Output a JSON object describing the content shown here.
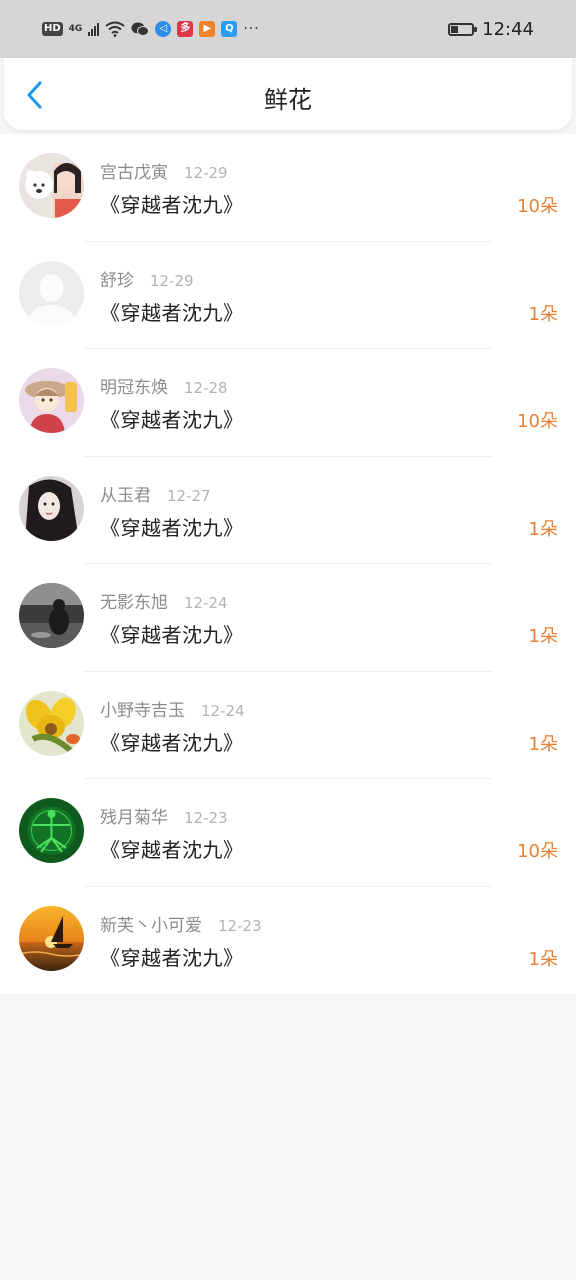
{
  "status_bar": {
    "hd": "HD",
    "network": "4G",
    "time": "12:44",
    "more": "···"
  },
  "header": {
    "title": "鲜花"
  },
  "items": [
    {
      "name": "宫古戊寅",
      "date": "12-29",
      "book": "《穿越者沈九》",
      "count": "10朵",
      "avatar": "bear-avatar"
    },
    {
      "name": "舒珍",
      "date": "12-29",
      "book": "《穿越者沈九》",
      "count": "1朵",
      "avatar": "default-avatar"
    },
    {
      "name": "明冠东焕",
      "date": "12-28",
      "book": "《穿越者沈九》",
      "count": "10朵",
      "avatar": "cartoon-avatar"
    },
    {
      "name": "从玉君",
      "date": "12-27",
      "book": "《穿越者沈九》",
      "count": "1朵",
      "avatar": "portrait-avatar"
    },
    {
      "name": "无影东旭",
      "date": "12-24",
      "book": "《穿越者沈九》",
      "count": "1朵",
      "avatar": "dark-photo-avatar"
    },
    {
      "name": "小野寺吉玉",
      "date": "12-24",
      "book": "《穿越者沈九》",
      "count": "1朵",
      "avatar": "flower-avatar"
    },
    {
      "name": "残月菊华",
      "date": "12-23",
      "book": "《穿越者沈九》",
      "count": "10朵",
      "avatar": "green-figure-avatar"
    },
    {
      "name": "新芙丶小可爱",
      "date": "12-23",
      "book": "《穿越者沈九》",
      "count": "1朵",
      "avatar": "sunset-sailboat-avatar"
    }
  ],
  "colors": {
    "accent": "#1a9bea",
    "count": "#e87f33"
  }
}
